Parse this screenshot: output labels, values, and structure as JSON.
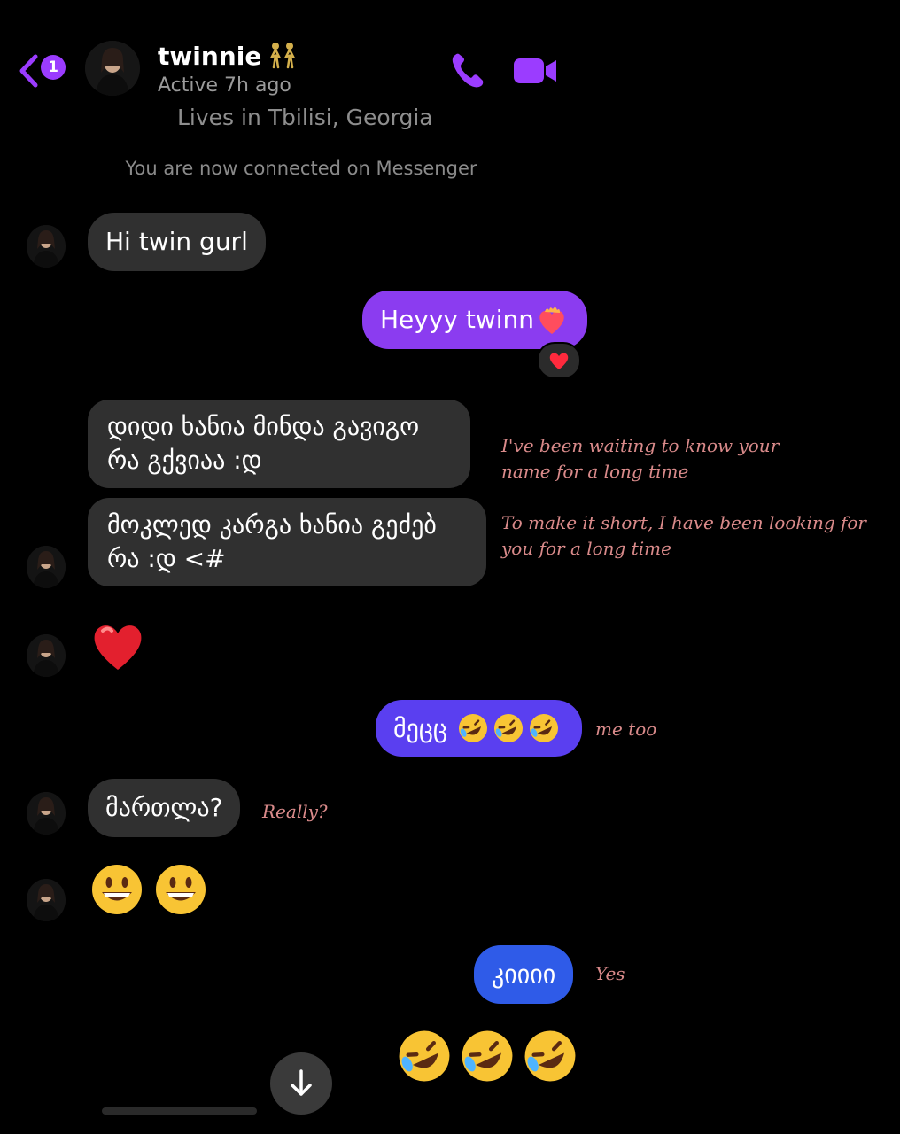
{
  "header": {
    "unread_count": "1",
    "contact_name": "twinnie",
    "status": "Active 7h ago",
    "accent_color": "#9b3cff"
  },
  "profile_info": "Lives in Tbilisi, Georgia",
  "system_message": "You are now connected on Messenger",
  "messages": [
    {
      "text": "Hi twin  gurl"
    },
    {
      "text": "Heyyy twinn"
    },
    {
      "text": "დიდი ხანია მინდა გავიგო რა გქვიაა :დ"
    },
    {
      "text": "მოკლედ კარგა ხანია გეძებ რა :დ <#"
    },
    {
      "text": "მეცც"
    },
    {
      "text": "მართლა?"
    },
    {
      "text": "კიიიი"
    }
  ],
  "translations": [
    "I've been waiting to know your name for a long time",
    "To make it short, I have been looking for you for a long time",
    "me too",
    "Really?",
    "Yes"
  ],
  "icons": {
    "back": "chevron-left-icon",
    "call": "phone-icon",
    "video": "video-camera-icon",
    "scroll": "arrow-down-icon"
  }
}
